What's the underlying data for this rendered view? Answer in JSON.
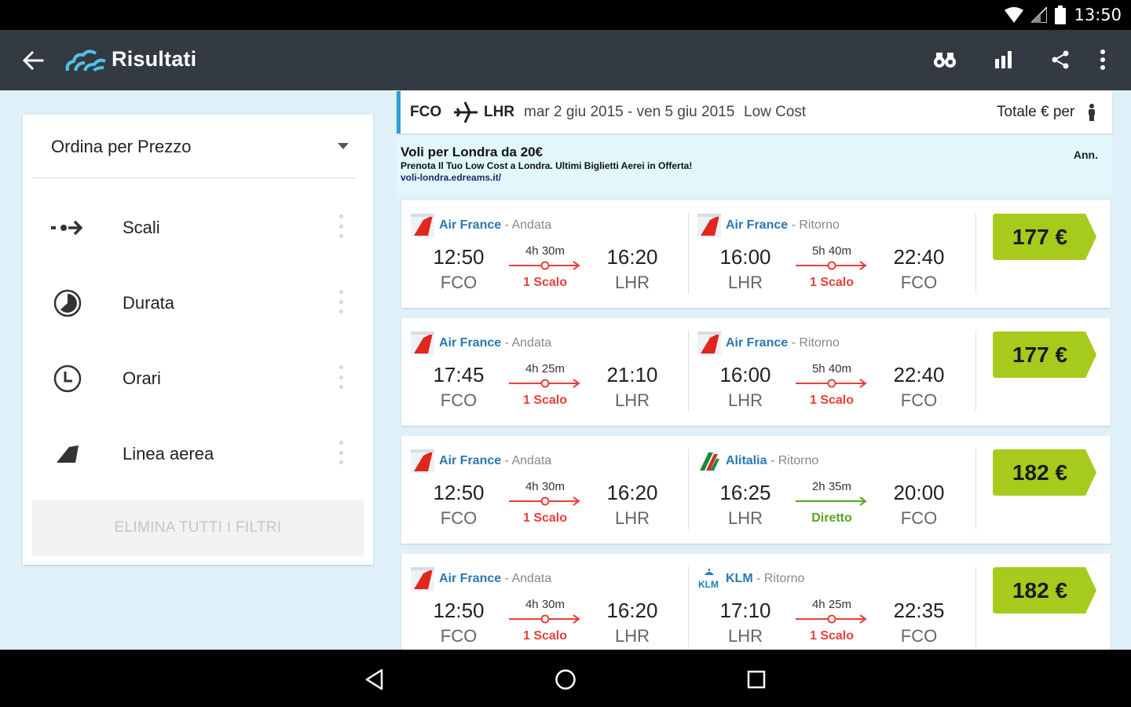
{
  "status_bar": {
    "time": "13:50",
    "icons": [
      "wifi-icon",
      "cell-signal-icon",
      "battery-icon"
    ]
  },
  "app_bar": {
    "title": "Risultati",
    "actions": [
      "binoculars-icon",
      "bar-chart-icon",
      "share-icon",
      "more-vert-icon"
    ]
  },
  "sort": {
    "label": "Ordina per Prezzo"
  },
  "filters": [
    {
      "label": "Scali",
      "icon": "stops-icon"
    },
    {
      "label": "Durata",
      "icon": "duration-icon"
    },
    {
      "label": "Orari",
      "icon": "clock-icon"
    },
    {
      "label": "Linea aerea",
      "icon": "airline-tail-icon"
    }
  ],
  "clear_filters": "ELIMINA TUTTI I FILTRI",
  "search": {
    "origin": "FCO",
    "destination": "LHR",
    "dates": "mar 2 giu 2015 - ven 5 giu 2015",
    "fare_type": "Low Cost",
    "total_label": "Totale € per"
  },
  "ad": {
    "title": "Voli per Londra da 20€",
    "description": "Prenota Il Tuo Low Cost a Londra. Ultimi Biglietti Aerei in Offerta!",
    "url": "voli-londra.edreams.it/",
    "tag": "Ann."
  },
  "colors": {
    "stop_red": "#e8403a",
    "direct_green": "#5aa51f",
    "price_bg": "#a6cb1c",
    "accent": "#2a9fd6"
  },
  "results": [
    {
      "price": "177 €",
      "outbound": {
        "airline": "Air France",
        "direction": "Andata",
        "logo": "air-france-logo",
        "dep_time": "12:50",
        "dep_code": "FCO",
        "duration": "4h 30m",
        "stops": "1 Scalo",
        "arr_time": "16:20",
        "arr_code": "LHR"
      },
      "return": {
        "airline": "Air France",
        "direction": "Ritorno",
        "logo": "air-france-logo",
        "dep_time": "16:00",
        "dep_code": "LHR",
        "duration": "5h 40m",
        "stops": "1 Scalo",
        "arr_time": "22:40",
        "arr_code": "FCO"
      }
    },
    {
      "price": "177 €",
      "outbound": {
        "airline": "Air France",
        "direction": "Andata",
        "logo": "air-france-logo",
        "dep_time": "17:45",
        "dep_code": "FCO",
        "duration": "4h 25m",
        "stops": "1 Scalo",
        "arr_time": "21:10",
        "arr_code": "LHR"
      },
      "return": {
        "airline": "Air France",
        "direction": "Ritorno",
        "logo": "air-france-logo",
        "dep_time": "16:00",
        "dep_code": "LHR",
        "duration": "5h 40m",
        "stops": "1 Scalo",
        "arr_time": "22:40",
        "arr_code": "FCO"
      }
    },
    {
      "price": "182 €",
      "outbound": {
        "airline": "Air France",
        "direction": "Andata",
        "logo": "air-france-logo",
        "dep_time": "12:50",
        "dep_code": "FCO",
        "duration": "4h 30m",
        "stops": "1 Scalo",
        "arr_time": "16:20",
        "arr_code": "LHR"
      },
      "return": {
        "airline": "Alitalia",
        "direction": "Ritorno",
        "logo": "alitalia-logo",
        "dep_time": "16:25",
        "dep_code": "LHR",
        "duration": "2h 35m",
        "stops": "Diretto",
        "arr_time": "20:00",
        "arr_code": "FCO"
      }
    },
    {
      "price": "182 €",
      "outbound": {
        "airline": "Air France",
        "direction": "Andata",
        "logo": "air-france-logo",
        "dep_time": "12:50",
        "dep_code": "FCO",
        "duration": "4h 30m",
        "stops": "1 Scalo",
        "arr_time": "16:20",
        "arr_code": "LHR"
      },
      "return": {
        "airline": "KLM",
        "direction": "Ritorno",
        "logo": "klm-logo",
        "dep_time": "17:10",
        "dep_code": "LHR",
        "duration": "4h 25m",
        "stops": "1 Scalo",
        "arr_time": "22:35",
        "arr_code": "FCO"
      }
    }
  ],
  "nav_bar": [
    "back-nav-icon",
    "home-nav-icon",
    "recents-nav-icon"
  ]
}
